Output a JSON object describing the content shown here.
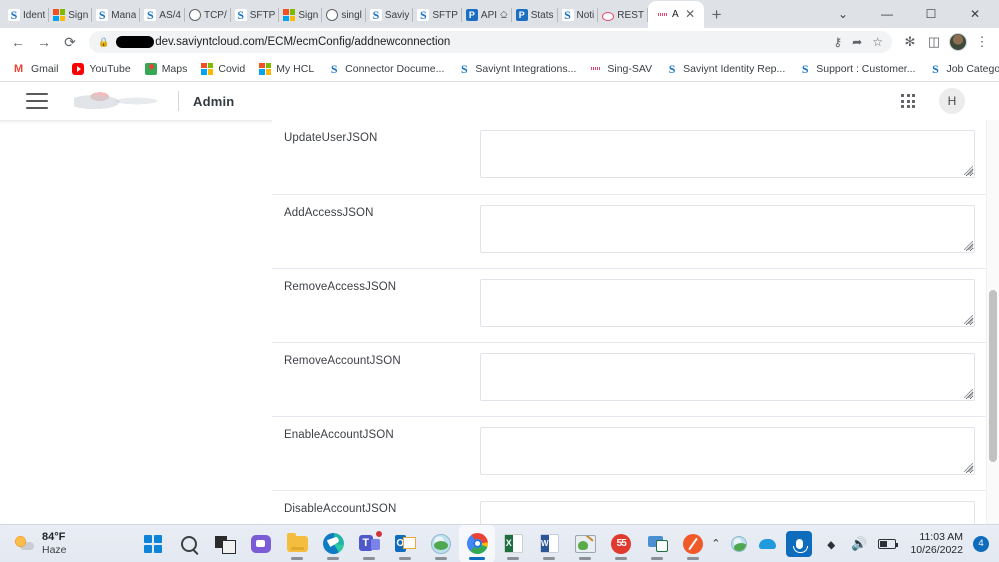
{
  "browser": {
    "tabs": [
      {
        "label": "Ident",
        "favicon": "saviynt-icon"
      },
      {
        "label": "Sign",
        "favicon": "microsoft-icon"
      },
      {
        "label": "Manа",
        "favicon": "saviynt-icon"
      },
      {
        "label": "AS/4",
        "favicon": "saviynt-icon"
      },
      {
        "label": "TCP/",
        "favicon": "globe-icon"
      },
      {
        "label": "SFTP",
        "favicon": "saviynt-icon"
      },
      {
        "label": "Sign",
        "favicon": "microsoft-icon"
      },
      {
        "label": "singl",
        "favicon": "globe-icon"
      },
      {
        "label": "Saviy",
        "favicon": "saviynt-icon"
      },
      {
        "label": "SFTP",
        "favicon": "saviynt-icon"
      },
      {
        "label": "API ⎐",
        "favicon": "postman-icon"
      },
      {
        "label": "Stats",
        "favicon": "postman-icon"
      },
      {
        "label": "Noti",
        "favicon": "saviynt-icon"
      },
      {
        "label": "REST",
        "favicon": "ring-icon"
      }
    ],
    "active_tab": {
      "label": "A",
      "favicon": "signature-icon",
      "close": "✕"
    },
    "new_tab_label": "+",
    "window_controls": {
      "minimize": "—",
      "maximize": "☐",
      "close": "✕",
      "more": "⌄"
    },
    "nav": {
      "back": "←",
      "forward": "→",
      "reload": "⟳"
    },
    "omnibox": {
      "lock_icon": "lock-icon",
      "url_redacted": true,
      "url": "dev.saviyntcloud.com/ECM/ecmConfig/addnewconnection",
      "actions": {
        "key": "⚷",
        "share": "➦",
        "bookmark": "☆"
      }
    },
    "toolbar_icons": {
      "extensions": "✻",
      "sidepanel": "◫",
      "profile": "avatar-icon",
      "menu": "⋮"
    },
    "bookmarks": [
      {
        "label": "Gmail",
        "favicon": "gmail-icon"
      },
      {
        "label": "YouTube",
        "favicon": "youtube-icon"
      },
      {
        "label": "Maps",
        "favicon": "maps-icon"
      },
      {
        "label": "Covid",
        "favicon": "microsoft-icon"
      },
      {
        "label": "My HCL",
        "favicon": "microsoft-icon"
      },
      {
        "label": "Connector Docume...",
        "favicon": "saviynt-icon"
      },
      {
        "label": "Saviynt Integrations...",
        "favicon": "saviynt-icon"
      },
      {
        "label": "Sing-SAV",
        "favicon": "signature-icon"
      },
      {
        "label": "Saviynt Identity Rep...",
        "favicon": "saviynt-icon"
      },
      {
        "label": "Support : Customer...",
        "favicon": "saviynt-icon"
      },
      {
        "label": "Job Categories for...",
        "favicon": "saviynt-icon"
      }
    ]
  },
  "app": {
    "header": {
      "menu_icon": "hamburger-icon",
      "logo": "saviynt-logo",
      "title": "Admin",
      "apps_icon": "apps-grid-icon",
      "avatar_initial": "H"
    },
    "form": {
      "fields": [
        {
          "label": "UpdateUserJSON",
          "value": "",
          "placeholder": ""
        },
        {
          "label": "AddAccessJSON",
          "value": "",
          "placeholder": ""
        },
        {
          "label": "RemoveAccessJSON",
          "value": "",
          "placeholder": ""
        },
        {
          "label": "RemoveAccountJSON",
          "value": "",
          "placeholder": ""
        },
        {
          "label": "EnableAccountJSON",
          "value": "",
          "placeholder": ""
        },
        {
          "label": "DisableAccountJSON",
          "value": "",
          "placeholder": ""
        }
      ]
    }
  },
  "taskbar": {
    "weather": {
      "temperature": "84°F",
      "condition": "Haze",
      "icon": "haze-sun-icon"
    },
    "apps": [
      {
        "name": "start-button",
        "icon": "windows-start-icon",
        "running": false,
        "active": false
      },
      {
        "name": "search",
        "icon": "search-icon",
        "running": false,
        "active": false
      },
      {
        "name": "task-view",
        "icon": "task-view-icon",
        "running": false,
        "active": false
      },
      {
        "name": "chat",
        "icon": "teams-chat-icon",
        "running": false,
        "active": false
      },
      {
        "name": "file-explorer",
        "icon": "folder-icon",
        "running": true,
        "active": false
      },
      {
        "name": "edge",
        "icon": "edge-icon",
        "running": true,
        "active": false
      },
      {
        "name": "teams",
        "icon": "teams-icon",
        "running": true,
        "active": false,
        "badge": true
      },
      {
        "name": "outlook",
        "icon": "outlook-icon",
        "running": true,
        "active": false
      },
      {
        "name": "globe-app",
        "icon": "globe-app-icon",
        "running": true,
        "active": false
      },
      {
        "name": "chrome",
        "icon": "chrome-icon",
        "running": true,
        "active": true
      },
      {
        "name": "excel",
        "icon": "excel-icon",
        "running": true,
        "active": false
      },
      {
        "name": "word",
        "icon": "word-icon",
        "running": true,
        "active": false
      },
      {
        "name": "paint",
        "icon": "paint-icon",
        "running": true,
        "active": false
      },
      {
        "name": "ss-app",
        "icon": "ss-red-icon",
        "running": true,
        "active": false
      },
      {
        "name": "xl-share",
        "icon": "excel-share-icon",
        "running": true,
        "active": false
      },
      {
        "name": "orange-app",
        "icon": "orange-pen-icon",
        "running": true,
        "active": false
      }
    ],
    "tray": {
      "overflow": "⌃",
      "icons": [
        "globe-tray-icon",
        "onedrive-icon",
        "microphone-icon",
        "wifi-icon",
        "volume-icon",
        "battery-icon"
      ],
      "time": "11:03 AM",
      "date": "10/26/2022",
      "notification_count": "4"
    }
  }
}
